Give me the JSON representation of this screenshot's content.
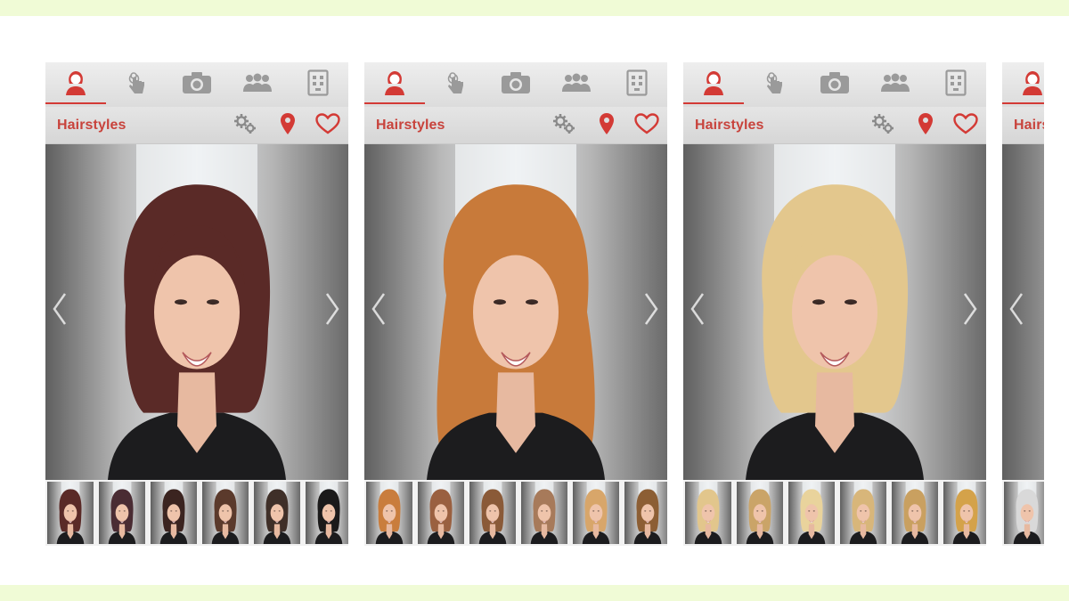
{
  "app": {
    "title": "Hairstyles",
    "accent_color": "#d33a35",
    "tabs": [
      {
        "icon": "woman-silhouette-icon",
        "active": true
      },
      {
        "icon": "touch-hand-icon",
        "active": false
      },
      {
        "icon": "camera-icon",
        "active": false
      },
      {
        "icon": "group-people-icon",
        "active": false
      },
      {
        "icon": "grid-menu-icon",
        "active": false
      }
    ],
    "actions": [
      {
        "icon": "settings-gears-icon"
      },
      {
        "icon": "location-pin-icon"
      },
      {
        "icon": "heart-icon"
      }
    ]
  },
  "screens": [
    {
      "style": "Dark auburn bob with bangs",
      "hair_color": "#5a2a27",
      "thumbnails": [
        {
          "hair_color": "#5a2a27",
          "selected": true
        },
        {
          "hair_color": "#4a2c33",
          "selected": false
        },
        {
          "hair_color": "#3b2420",
          "selected": false
        },
        {
          "hair_color": "#5b3a2c",
          "selected": false
        },
        {
          "hair_color": "#3f2f28",
          "selected": false
        },
        {
          "hair_color": "#1b1a1a",
          "selected": false
        }
      ]
    },
    {
      "style": "Long copper waves",
      "hair_color": "#c87a3a",
      "thumbnails": [
        {
          "hair_color": "#c97d3d",
          "selected": true
        },
        {
          "hair_color": "#9a6040",
          "selected": false
        },
        {
          "hair_color": "#8a5a38",
          "selected": false
        },
        {
          "hair_color": "#a77a5a",
          "selected": false
        },
        {
          "hair_color": "#d8a66a",
          "selected": false
        },
        {
          "hair_color": "#8c5e34",
          "selected": false
        }
      ]
    },
    {
      "style": "Short blonde bob",
      "hair_color": "#e3c78d",
      "thumbnails": [
        {
          "hair_color": "#e2c68c",
          "selected": true
        },
        {
          "hair_color": "#caa468",
          "selected": false
        },
        {
          "hair_color": "#e9d39c",
          "selected": false
        },
        {
          "hair_color": "#d8b67a",
          "selected": false
        },
        {
          "hair_color": "#c9a060",
          "selected": false
        },
        {
          "hair_color": "#d4a24a",
          "selected": false
        }
      ]
    },
    {
      "style": "Partially visible screen",
      "hair_color": "#cfcfcf",
      "thumbnails": [
        {
          "hair_color": "#d9d9d9",
          "selected": true
        }
      ]
    }
  ]
}
